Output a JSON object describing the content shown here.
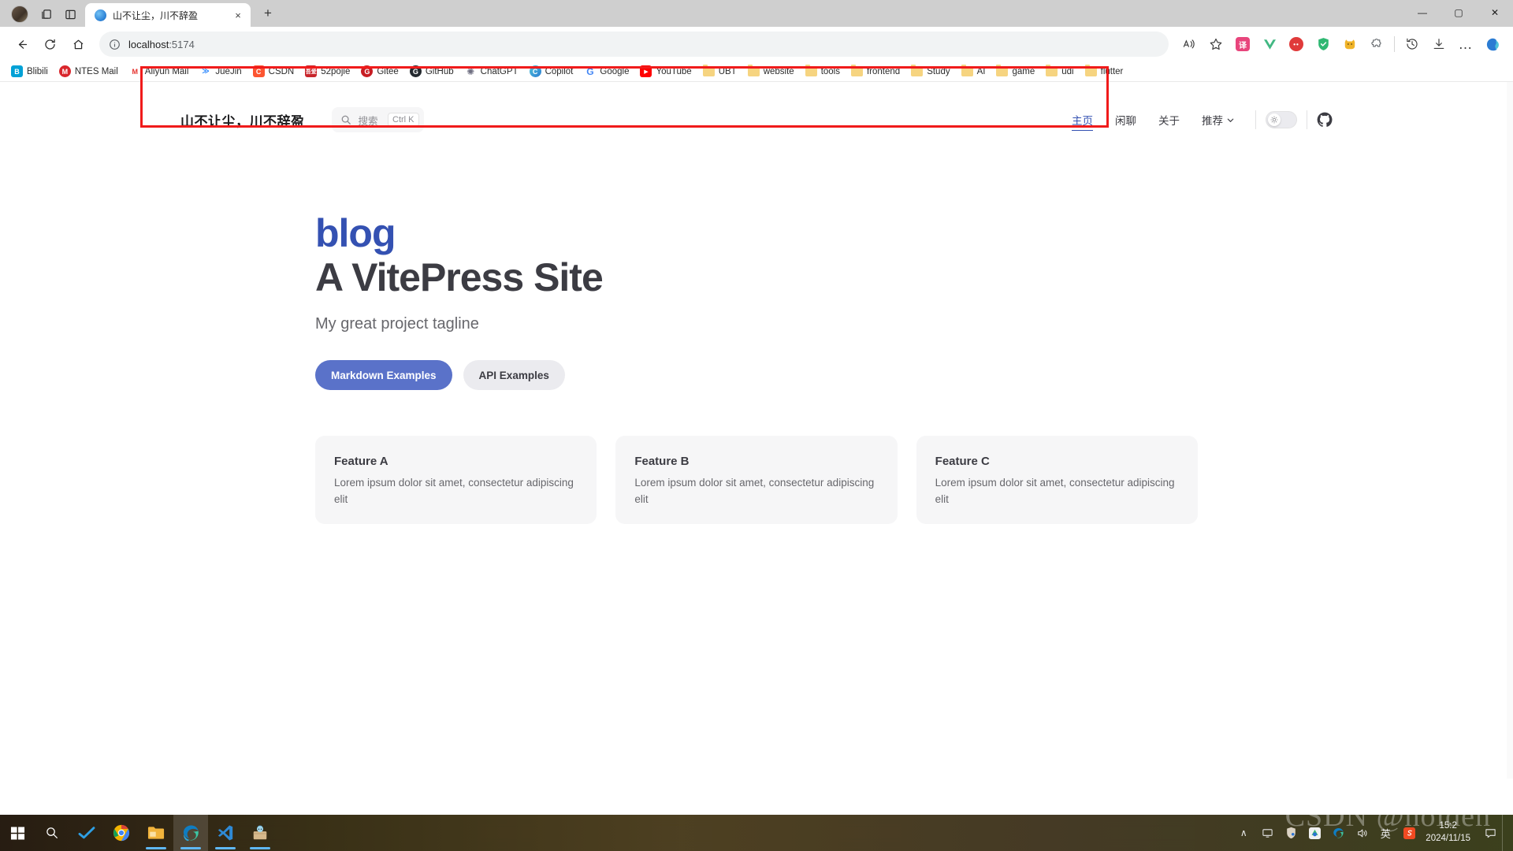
{
  "browser": {
    "tab": {
      "title": "山不让尘，川不辞盈",
      "favicon": "globe-icon",
      "close": "×"
    },
    "new_tab": "+",
    "window_controls": {
      "minimize": "—",
      "maximize": "▢",
      "close": "✕"
    },
    "toolbar": {
      "back": "←",
      "refresh": "⟳",
      "home": "⌂",
      "url": "localhost",
      "url_port": ":5174",
      "site_info": "ⓘ",
      "read_aloud": "A",
      "favorite": "☆",
      "extensions": [
        {
          "name": "translate-extension",
          "label": "译",
          "color": "#e8457c"
        },
        {
          "name": "vue-devtools-extension",
          "label": "V",
          "color": "#42b883"
        },
        {
          "name": "red-dot-extension",
          "label": "••",
          "color": "#e03a3a"
        },
        {
          "name": "adblock-shield-extension",
          "label": "✓",
          "color": "#2eb872"
        },
        {
          "name": "cat-extension",
          "label": "🐱",
          "color": "#f0b429"
        },
        {
          "name": "puzzle-extension",
          "label": "🧩",
          "color": "#5f6368"
        }
      ],
      "history": "↺",
      "downloads": "↓",
      "settings_more": "…",
      "copilot": "◈"
    },
    "bookmarks": [
      {
        "label": "Blibili",
        "icon_text": "B",
        "color": "#00a1d6",
        "type": "site"
      },
      {
        "label": "NTES Mail",
        "icon_text": "M",
        "color": "#d9262c",
        "type": "site"
      },
      {
        "label": "Aliyun Mail",
        "icon_text": "M",
        "color": "#e6322e",
        "type": "site"
      },
      {
        "label": "JueJin",
        "icon_text": "J",
        "color": "#1e80ff",
        "type": "site"
      },
      {
        "label": "CSDN",
        "icon_text": "C",
        "color": "#fc5531",
        "type": "site"
      },
      {
        "label": "52pojie",
        "icon_text": "52",
        "color": "#c8252b",
        "type": "site"
      },
      {
        "label": "Gitee",
        "icon_text": "G",
        "color": "#c71d23",
        "type": "site"
      },
      {
        "label": "GitHub",
        "icon_text": "G",
        "color": "#24292f",
        "type": "site"
      },
      {
        "label": "ChatGPT",
        "icon_text": "S",
        "color": "#6e6e80",
        "type": "site"
      },
      {
        "label": "Copilot",
        "icon_text": "C",
        "color": "#3b82f6",
        "type": "site"
      },
      {
        "label": "Google",
        "icon_text": "G",
        "color": "#4285f4",
        "type": "site"
      },
      {
        "label": "YouTube",
        "icon_text": "▶",
        "color": "#ff0000",
        "type": "site"
      },
      {
        "label": "UBT",
        "icon_text": "",
        "color": "",
        "type": "folder"
      },
      {
        "label": "website",
        "icon_text": "",
        "color": "",
        "type": "folder"
      },
      {
        "label": "tools",
        "icon_text": "",
        "color": "",
        "type": "folder"
      },
      {
        "label": "frontend",
        "icon_text": "",
        "color": "",
        "type": "folder"
      },
      {
        "label": "Study",
        "icon_text": "",
        "color": "",
        "type": "folder"
      },
      {
        "label": "AI",
        "icon_text": "",
        "color": "",
        "type": "folder"
      },
      {
        "label": "game",
        "icon_text": "",
        "color": "",
        "type": "folder"
      },
      {
        "label": "udi",
        "icon_text": "",
        "color": "",
        "type": "folder"
      },
      {
        "label": "flutter",
        "icon_text": "",
        "color": "",
        "type": "folder"
      }
    ]
  },
  "site": {
    "nav": {
      "title": "山不让尘，川不辞盈",
      "search": {
        "placeholder": "搜索",
        "shortcut": "Ctrl K",
        "icon": "search-icon"
      },
      "menu": [
        {
          "label": "主页",
          "active": true
        },
        {
          "label": "闲聊",
          "active": false
        },
        {
          "label": "关于",
          "active": false
        },
        {
          "label": "推荐",
          "active": false,
          "has_dropdown": true,
          "chevron": "⌄"
        }
      ],
      "appearance_toggle": {
        "name": "theme-toggle",
        "state": "light",
        "icon": "sun-icon"
      },
      "social": {
        "name": "github-link",
        "icon": "github-icon"
      }
    },
    "hero": {
      "name": "blog",
      "text": "A VitePress Site",
      "tagline": "My great project tagline",
      "actions": [
        {
          "label": "Markdown Examples",
          "theme": "brand"
        },
        {
          "label": "API Examples",
          "theme": "alt"
        }
      ]
    },
    "features": [
      {
        "title": "Feature A",
        "details": "Lorem ipsum dolor sit amet, consectetur adipiscing elit"
      },
      {
        "title": "Feature B",
        "details": "Lorem ipsum dolor sit amet, consectetur adipiscing elit"
      },
      {
        "title": "Feature C",
        "details": "Lorem ipsum dolor sit amet, consectetur adipiscing elit"
      }
    ],
    "colors": {
      "brand": "#3451b2",
      "brand_button": "#5a72c9",
      "alt_soft": "#ebebef",
      "card": "#f6f6f7"
    }
  },
  "annotation": {
    "name": "red-highlight-box",
    "color": "#f01b1b"
  },
  "taskbar": {
    "items": [
      {
        "name": "start-button",
        "label": "⊞",
        "running": false,
        "focused": false
      },
      {
        "name": "search-taskbar-button",
        "label": "○",
        "running": false,
        "focused": false
      },
      {
        "name": "todo-app",
        "label": "✔",
        "running": false,
        "focused": false
      },
      {
        "name": "chrome-app",
        "label": "C",
        "running": false,
        "focused": false
      },
      {
        "name": "file-explorer-app",
        "label": "▤",
        "running": true,
        "focused": false
      },
      {
        "name": "edge-app",
        "label": "e",
        "running": true,
        "focused": true
      },
      {
        "name": "vscode-app",
        "label": "X",
        "running": true,
        "focused": false
      },
      {
        "name": "anime-app",
        "label": "A",
        "running": true,
        "focused": false
      }
    ],
    "tray": [
      {
        "name": "show-hidden-icons",
        "label": "∧"
      },
      {
        "name": "network-monitor-icon",
        "label": "🖥"
      },
      {
        "name": "security-icon",
        "label": "🛡"
      },
      {
        "name": "app-tray-icon",
        "label": "◉"
      },
      {
        "name": "edge-tray-icon",
        "label": "e"
      },
      {
        "name": "volume-icon",
        "label": "🔊"
      },
      {
        "name": "ime-icon",
        "label": "英"
      },
      {
        "name": "sogou-ime-icon",
        "label": "S"
      }
    ],
    "clock": {
      "time": "15:2",
      "date": "2024/11/15"
    },
    "notifications": {
      "name": "notification-icon",
      "label": "▭"
    }
  },
  "watermark": {
    "text": "CSDN @holden"
  }
}
